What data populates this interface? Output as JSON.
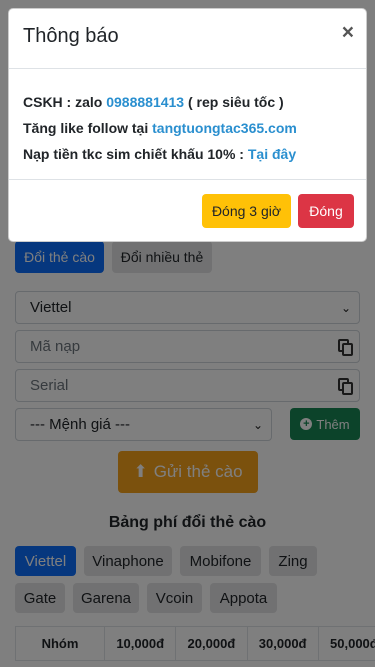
{
  "page": {
    "tabs": [
      "Đổi thẻ cào",
      "Đổi nhiều thẻ"
    ],
    "carrier_select": "Viettel",
    "code_placeholder": "Mã nạp",
    "serial_placeholder": "Serial",
    "amount_select": "--- Mệnh giá ---",
    "add_button": "Thêm",
    "submit_button": "Gửi thẻ cào",
    "fee_title": "Bảng phí đổi thẻ cào",
    "carriers_row1": [
      "Viettel",
      "Vinaphone",
      "Mobifone",
      "Zing"
    ],
    "carriers_row2": [
      "Gate",
      "Garena",
      "Vcoin",
      "Appota"
    ],
    "table_headers": [
      "Nhóm",
      "10,000đ",
      "20,000đ",
      "30,000đ",
      "50,000đ"
    ]
  },
  "modal": {
    "title": "Thông báo",
    "close": "×",
    "line1_prefix": "CSKH : zalo ",
    "line1_phone": "0988881413",
    "line1_suffix": " (  rep siêu tốc )",
    "line2_prefix": "Tăng like follow tại ",
    "line2_link": "tangtuongtac365.com",
    "line3_prefix": "Nạp tiền tkc sim chiết khấu 10% : ",
    "line3_link": "Tại đây",
    "btn_close_3h": "Đóng 3 giờ",
    "btn_close": "Đóng"
  },
  "colors": {
    "primary": "#0d6efd",
    "link": "#2a8fcf",
    "warning": "#ffc107",
    "danger": "#dc3545",
    "success": "#198754"
  }
}
